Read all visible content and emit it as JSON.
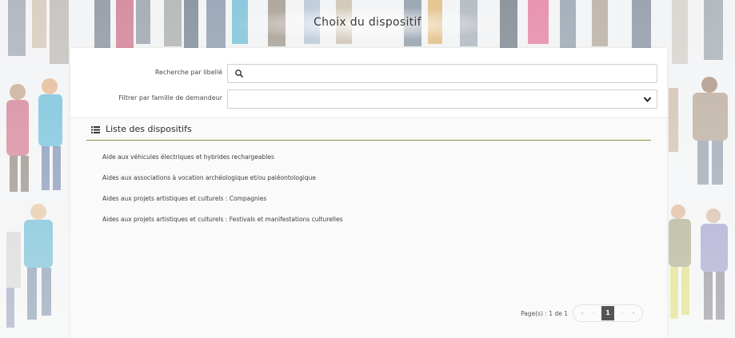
{
  "page": {
    "title": "Choix du dispositif"
  },
  "filters": {
    "search_label": "Recherche par libellé",
    "search_value": "",
    "search_icon": "search-icon",
    "family_label": "Filtrer par famille de demandeur",
    "family_value": ""
  },
  "list": {
    "icon": "list-icon",
    "title": "Liste des dispositifs",
    "items": [
      "Aide aux véhicules électriques et hybrides rechargeables",
      "Aides aux associations à vocation archéologique et/ou paléontologique",
      "Aides aux projets artistiques et culturels : Compagnies",
      "Aides aux projets artistiques et culturels : Festivals et manifestations culturelles"
    ]
  },
  "pagination": {
    "pages_text": "Page(s) : 1 de 1",
    "first": "«",
    "prev": "‹",
    "current": "1",
    "next": "›",
    "last": "»"
  },
  "colors": {
    "accent_line": "#7a9a3c",
    "current_page": "#555555"
  }
}
